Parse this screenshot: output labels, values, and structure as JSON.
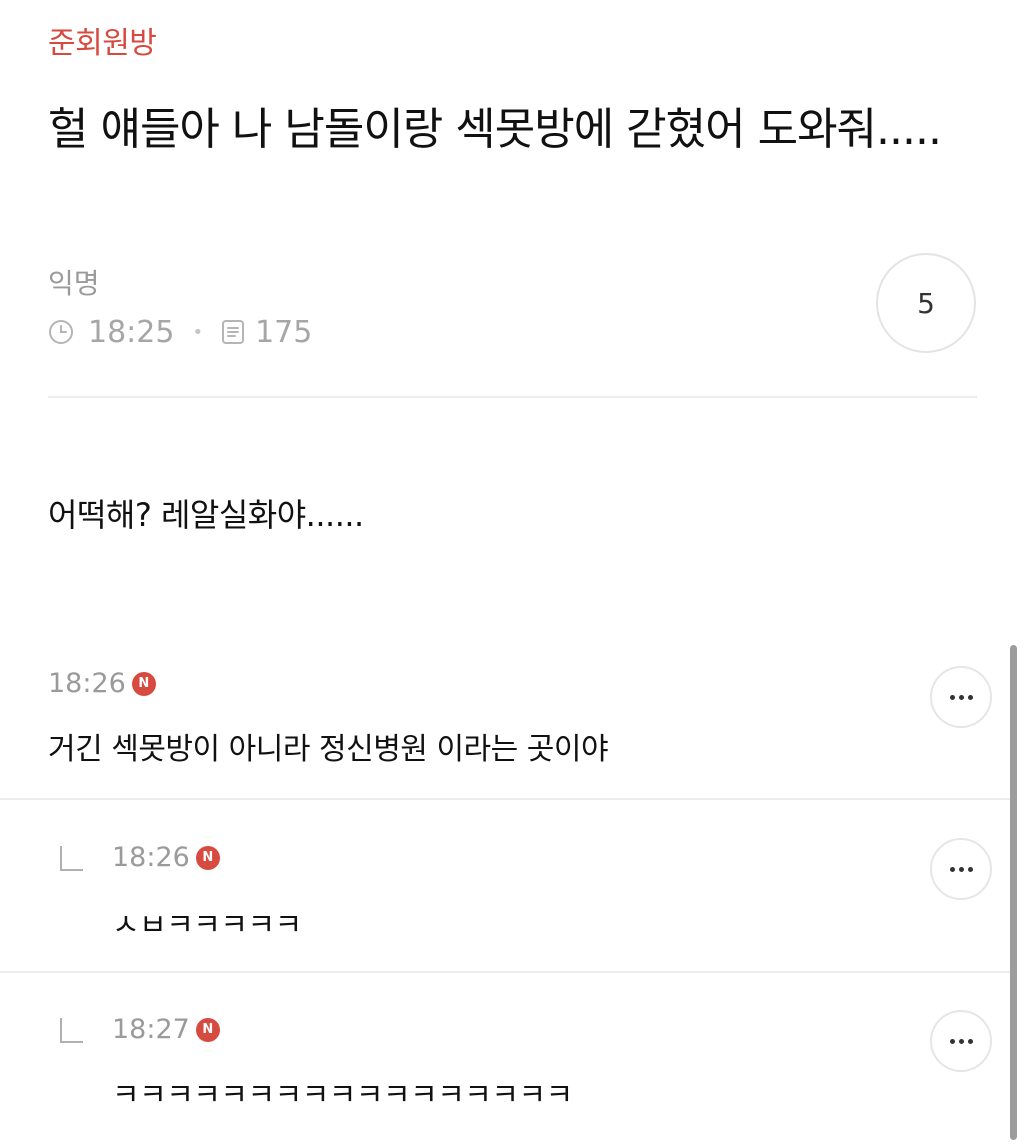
{
  "post": {
    "board": "준회원방",
    "title": "헐 얘들아 나 남돌이랑 섹못방에 갇혔어 도와줘.....",
    "author": "익명",
    "time": "18:25",
    "views": "175",
    "comment_count": "5",
    "body": "어떡해? 레알실화야......"
  },
  "comments": [
    {
      "time": "18:26",
      "badge": "N",
      "text": "거긴 섹못방이 아니라 정신병원 이라는 곳이야",
      "is_reply": false
    },
    {
      "time": "18:26",
      "badge": "N",
      "text": "ㅅㅂㅋㅋㅋㅋㅋ",
      "is_reply": true
    },
    {
      "time": "18:27",
      "badge": "N",
      "text": "ㅋㅋㅋㅋㅋㅋㅋㅋㅋㅋㅋㅋㅋㅋㅋㅋㅋ",
      "is_reply": true
    }
  ],
  "colors": {
    "accent": "#d64a3f",
    "muted": "#9a9a9a",
    "divider": "#ececec"
  },
  "icons": [
    "clock-icon",
    "document-icon",
    "reply-arrow-icon",
    "more-icon"
  ]
}
